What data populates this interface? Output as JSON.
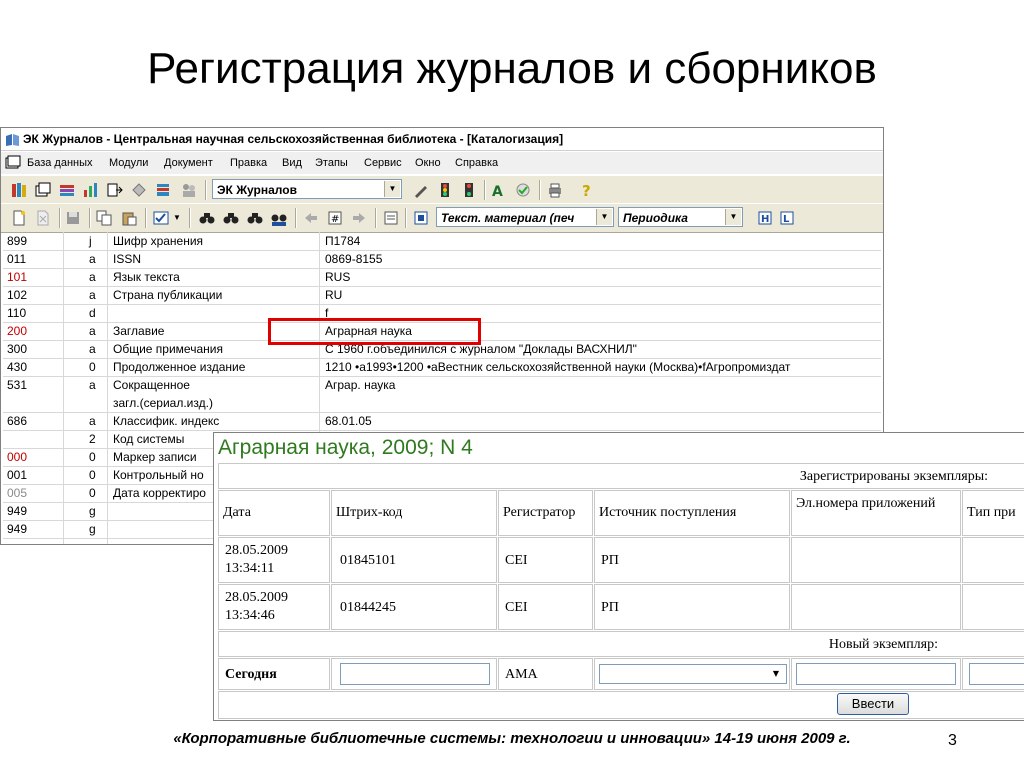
{
  "slide": {
    "title": "Регистрация журналов и сборников",
    "footer": "«Корпоративные библиотечные системы: технологии и инновации» 14-19 июня 2009 г.",
    "page_number": "3"
  },
  "window": {
    "title": "ЭК Журналов - Центральная научная сельскохозяйственная библиотека - [Каталогизация]"
  },
  "menu": [
    "База данных",
    "Модули",
    "Документ",
    "Правка",
    "Вид",
    "Этапы",
    "Сервис",
    "Окно",
    "Справка"
  ],
  "toolbar": {
    "database_combo": "ЭК Журналов",
    "material_combo": "Текст. материал (печ",
    "type_combo": "Периодика"
  },
  "marc_rows": [
    {
      "tag": "899",
      "ind": "j",
      "name": "Шифр хранения",
      "value": "П1784"
    },
    {
      "tag": "011",
      "ind": "a",
      "name": "ISSN",
      "value": "0869-8155"
    },
    {
      "tag": "101",
      "ind": "a",
      "name": "Язык текста",
      "value": "RUS",
      "tag_color": "red"
    },
    {
      "tag": "102",
      "ind": "a",
      "name": "Страна публикации",
      "value": "RU"
    },
    {
      "tag": "110",
      "ind": "d",
      "name": "",
      "value": "f"
    },
    {
      "tag": "200",
      "ind": "a",
      "name": "Заглавие",
      "value": "Аграрная наука",
      "tag_color": "red"
    },
    {
      "tag": "300",
      "ind": "a",
      "name": "Общие примечания",
      "value": "С 1960 г.объединился с журналом \"Доклады ВАСХНИЛ\""
    },
    {
      "tag": "430",
      "ind": "0",
      "name": "Продолженное издание",
      "value": "1210 •a1993•1200 •aВестник сельскохозяйственной науки (Москва)•fАгропромиздат"
    },
    {
      "tag": "531",
      "ind": "a",
      "name": "Сокращенное",
      "name2": "загл.(сериал.изд.)",
      "value": "Агpap. наука"
    },
    {
      "tag": "686",
      "ind": "a",
      "name": "Классифик. индекс",
      "value": "68.01.05"
    },
    {
      "tag": "",
      "ind": "2",
      "name": "Код системы",
      "value": ""
    },
    {
      "tag": "000",
      "ind": "0",
      "name": "Маркер записи",
      "value": "",
      "tag_color": "red"
    },
    {
      "tag": "001",
      "ind": "0",
      "name": "Контрольный но",
      "value": ""
    },
    {
      "tag": "005",
      "ind": "0",
      "name": "Дата корректиро",
      "value": "",
      "tag_color": "gray"
    },
    {
      "tag": "949",
      "ind": "g",
      "name": "",
      "value": ""
    },
    {
      "tag": "949",
      "ind": "g",
      "name": "",
      "value": ""
    }
  ],
  "record": {
    "title": "Аграрная наука, 2009; N 4",
    "registered_caption": "Зарегистрированы экземпляры:",
    "headers": [
      "Дата",
      "Штрих-код",
      "Регистратор",
      "Источник поступления",
      "Эл.номера приложений",
      "Тип при"
    ],
    "rows": [
      {
        "date": "28.05.2009",
        "time": "13:34:11",
        "barcode": "01845101",
        "registrar": "CEI",
        "source": "РП"
      },
      {
        "date": "28.05.2009",
        "time": "13:34:46",
        "barcode": "01844245",
        "registrar": "CEI",
        "source": "РП"
      }
    ],
    "new_caption": "Новый экземпляр:",
    "today_label": "Сегодня",
    "new_registrar": "AMA",
    "enter_button": "Ввести"
  },
  "colors": {
    "accent_red": "#e00000",
    "record_title": "#2f7a1f",
    "toolbar_bg": "#ece9d8"
  }
}
